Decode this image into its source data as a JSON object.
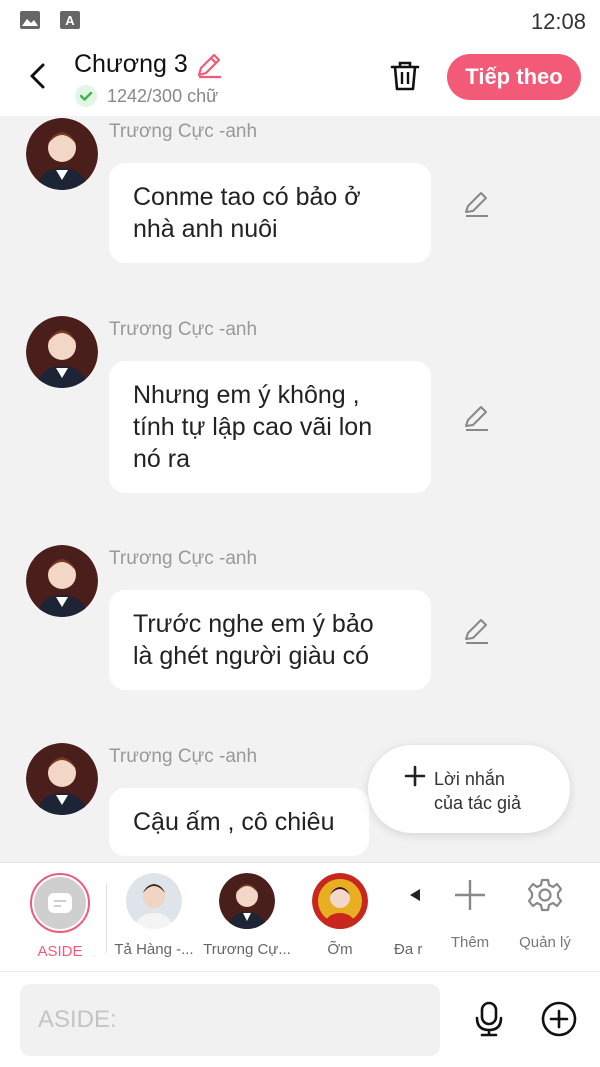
{
  "status_bar": {
    "time": "12:08"
  },
  "header": {
    "title": "Chương 3",
    "word_count": "1242/300 chữ",
    "next_button": "Tiếp theo"
  },
  "messages": [
    {
      "sender": "Trương Cực -anh",
      "text": "Conme tao có bảo ở\nnhà anh nuôi"
    },
    {
      "sender": "Trương Cực -anh",
      "text": "Nhưng em ý không ,\ntính tự lập cao vãi lon\nnó ra"
    },
    {
      "sender": "Trương Cực -anh",
      "text": "Trước nghe em ý bảo\nlà ghét người giàu có"
    },
    {
      "sender": "Trương Cực -anh",
      "text": "Cậu ấm , cô chiêu"
    }
  ],
  "author_note_button": "Lời nhắn\ncủa tác giả",
  "characters": {
    "aside": "ASIDE",
    "items": [
      "Tả Hàng -...",
      "Trương Cự...",
      "Ỡm",
      "Đa r"
    ]
  },
  "tools": {
    "add": "Thêm",
    "manage": "Quản lý"
  },
  "input": {
    "placeholder": "ASIDE:"
  },
  "colors": {
    "accent": "#f25a77",
    "background": "#f2f2f2",
    "bubble": "#ffffff"
  }
}
